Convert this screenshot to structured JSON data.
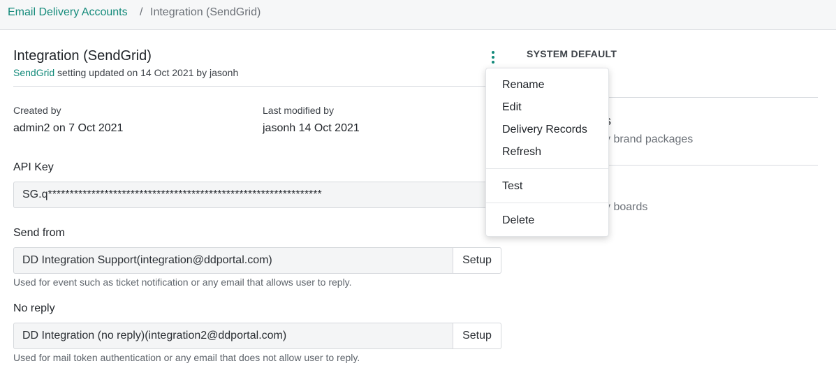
{
  "breadcrumb": {
    "parent": "Email Delivery Accounts",
    "separator": "/",
    "current": "Integration (SendGrid)"
  },
  "header": {
    "title": "Integration (SendGrid)",
    "subtitle_link": "SendGrid",
    "subtitle_text": " setting updated on 14 Oct 2021 by jasonh"
  },
  "meta": {
    "created_by_label": "Created by",
    "created_by_value": "admin2 on 7 Oct 2021",
    "modified_by_label": "Last modified by",
    "modified_by_value": "jasonh 14 Oct 2021"
  },
  "fields": {
    "api_key_label": "API Key",
    "api_key_value": "SG.q***************************************************************",
    "send_from_label": "Send from",
    "send_from_value": "DD Integration Support(integration@ddportal.com)",
    "send_from_setup": "Setup",
    "send_from_help": "Used for event such as ticket notification or any email that allows user to reply.",
    "no_reply_label": "No reply",
    "no_reply_value": "DD Integration (no reply)(integration2@ddportal.com)",
    "no_reply_setup": "Setup",
    "no_reply_help": "Used for mail token authentication or any email that does not allow user to reply."
  },
  "sidebar": {
    "heading": "SYSTEM DEFAULT",
    "partial_1": "s",
    "partial_2": "y brand packages",
    "partial_3": "y boards"
  },
  "menu": {
    "items": [
      "Rename",
      "Edit",
      "Delivery Records",
      "Refresh",
      "Test",
      "Delete"
    ]
  },
  "icons": {
    "kebab": "more-vertical-icon"
  },
  "colors": {
    "accent": "#138a7a"
  }
}
